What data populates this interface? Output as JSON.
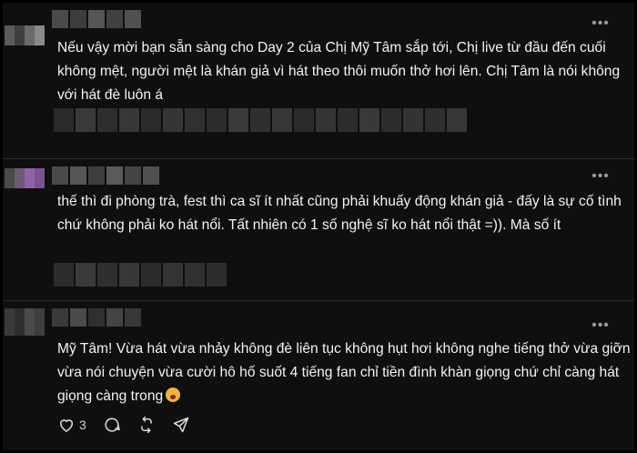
{
  "comments": [
    {
      "text": "Nếu vậy mời bạn sẵn sàng cho Day 2 của Chị Mỹ Tâm sắp tới, Chị live từ đầu đến cuối không mệt, người mệt là khán giả vì hát theo thôi muốn thở hơi lên. Chị Tâm là nói không với hát đè luôn á",
      "more": "•••"
    },
    {
      "text": "thế thì đi phòng trà, fest thì ca sĩ ít nhất cũng phải khuấy động khán giả - đấy là sự cố tình chứ không phải ko hát nổi. Tất nhiên có 1 số nghệ sĩ ko hát nổi thật =)). Mà số ít",
      "more": "•••"
    },
    {
      "text": "Mỹ Tâm! Vừa hát vừa nhảy không đè liên tục không hụt hơi không nghe tiếng thở vừa giỡn vừa nói chuyện vừa cười hô hố suốt 4 tiếng fan chỉ tiền đình khàn giọng chứ chỉ càng hát giọng càng trong",
      "emoji": "hushed-face-emoji",
      "more": "•••",
      "like_count": "3",
      "icons": [
        "heart-icon",
        "comment-icon",
        "repost-icon",
        "share-icon"
      ]
    }
  ],
  "colors": {
    "background": "#0f0f0f",
    "text": "#f3f3f3",
    "divider": "#2b2b2b",
    "avatar_purple": "#8e63a8"
  }
}
